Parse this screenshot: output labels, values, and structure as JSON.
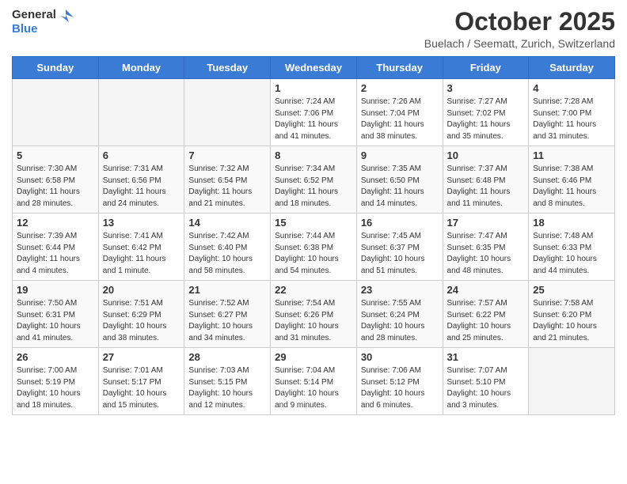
{
  "logo": {
    "text_general": "General",
    "text_blue": "Blue"
  },
  "header": {
    "month_title": "October 2025",
    "subtitle": "Buelach / Seematt, Zurich, Switzerland"
  },
  "days_of_week": [
    "Sunday",
    "Monday",
    "Tuesday",
    "Wednesday",
    "Thursday",
    "Friday",
    "Saturday"
  ],
  "weeks": [
    [
      {
        "day": "",
        "sunrise": "",
        "sunset": "",
        "daylight": "",
        "empty": true
      },
      {
        "day": "",
        "sunrise": "",
        "sunset": "",
        "daylight": "",
        "empty": true
      },
      {
        "day": "",
        "sunrise": "",
        "sunset": "",
        "daylight": "",
        "empty": true
      },
      {
        "day": "1",
        "sunrise": "Sunrise: 7:24 AM",
        "sunset": "Sunset: 7:06 PM",
        "daylight": "Daylight: 11 hours and 41 minutes."
      },
      {
        "day": "2",
        "sunrise": "Sunrise: 7:26 AM",
        "sunset": "Sunset: 7:04 PM",
        "daylight": "Daylight: 11 hours and 38 minutes."
      },
      {
        "day": "3",
        "sunrise": "Sunrise: 7:27 AM",
        "sunset": "Sunset: 7:02 PM",
        "daylight": "Daylight: 11 hours and 35 minutes."
      },
      {
        "day": "4",
        "sunrise": "Sunrise: 7:28 AM",
        "sunset": "Sunset: 7:00 PM",
        "daylight": "Daylight: 11 hours and 31 minutes."
      }
    ],
    [
      {
        "day": "5",
        "sunrise": "Sunrise: 7:30 AM",
        "sunset": "Sunset: 6:58 PM",
        "daylight": "Daylight: 11 hours and 28 minutes."
      },
      {
        "day": "6",
        "sunrise": "Sunrise: 7:31 AM",
        "sunset": "Sunset: 6:56 PM",
        "daylight": "Daylight: 11 hours and 24 minutes."
      },
      {
        "day": "7",
        "sunrise": "Sunrise: 7:32 AM",
        "sunset": "Sunset: 6:54 PM",
        "daylight": "Daylight: 11 hours and 21 minutes."
      },
      {
        "day": "8",
        "sunrise": "Sunrise: 7:34 AM",
        "sunset": "Sunset: 6:52 PM",
        "daylight": "Daylight: 11 hours and 18 minutes."
      },
      {
        "day": "9",
        "sunrise": "Sunrise: 7:35 AM",
        "sunset": "Sunset: 6:50 PM",
        "daylight": "Daylight: 11 hours and 14 minutes."
      },
      {
        "day": "10",
        "sunrise": "Sunrise: 7:37 AM",
        "sunset": "Sunset: 6:48 PM",
        "daylight": "Daylight: 11 hours and 11 minutes."
      },
      {
        "day": "11",
        "sunrise": "Sunrise: 7:38 AM",
        "sunset": "Sunset: 6:46 PM",
        "daylight": "Daylight: 11 hours and 8 minutes."
      }
    ],
    [
      {
        "day": "12",
        "sunrise": "Sunrise: 7:39 AM",
        "sunset": "Sunset: 6:44 PM",
        "daylight": "Daylight: 11 hours and 4 minutes."
      },
      {
        "day": "13",
        "sunrise": "Sunrise: 7:41 AM",
        "sunset": "Sunset: 6:42 PM",
        "daylight": "Daylight: 11 hours and 1 minute."
      },
      {
        "day": "14",
        "sunrise": "Sunrise: 7:42 AM",
        "sunset": "Sunset: 6:40 PM",
        "daylight": "Daylight: 10 hours and 58 minutes."
      },
      {
        "day": "15",
        "sunrise": "Sunrise: 7:44 AM",
        "sunset": "Sunset: 6:38 PM",
        "daylight": "Daylight: 10 hours and 54 minutes."
      },
      {
        "day": "16",
        "sunrise": "Sunrise: 7:45 AM",
        "sunset": "Sunset: 6:37 PM",
        "daylight": "Daylight: 10 hours and 51 minutes."
      },
      {
        "day": "17",
        "sunrise": "Sunrise: 7:47 AM",
        "sunset": "Sunset: 6:35 PM",
        "daylight": "Daylight: 10 hours and 48 minutes."
      },
      {
        "day": "18",
        "sunrise": "Sunrise: 7:48 AM",
        "sunset": "Sunset: 6:33 PM",
        "daylight": "Daylight: 10 hours and 44 minutes."
      }
    ],
    [
      {
        "day": "19",
        "sunrise": "Sunrise: 7:50 AM",
        "sunset": "Sunset: 6:31 PM",
        "daylight": "Daylight: 10 hours and 41 minutes."
      },
      {
        "day": "20",
        "sunrise": "Sunrise: 7:51 AM",
        "sunset": "Sunset: 6:29 PM",
        "daylight": "Daylight: 10 hours and 38 minutes."
      },
      {
        "day": "21",
        "sunrise": "Sunrise: 7:52 AM",
        "sunset": "Sunset: 6:27 PM",
        "daylight": "Daylight: 10 hours and 34 minutes."
      },
      {
        "day": "22",
        "sunrise": "Sunrise: 7:54 AM",
        "sunset": "Sunset: 6:26 PM",
        "daylight": "Daylight: 10 hours and 31 minutes."
      },
      {
        "day": "23",
        "sunrise": "Sunrise: 7:55 AM",
        "sunset": "Sunset: 6:24 PM",
        "daylight": "Daylight: 10 hours and 28 minutes."
      },
      {
        "day": "24",
        "sunrise": "Sunrise: 7:57 AM",
        "sunset": "Sunset: 6:22 PM",
        "daylight": "Daylight: 10 hours and 25 minutes."
      },
      {
        "day": "25",
        "sunrise": "Sunrise: 7:58 AM",
        "sunset": "Sunset: 6:20 PM",
        "daylight": "Daylight: 10 hours and 21 minutes."
      }
    ],
    [
      {
        "day": "26",
        "sunrise": "Sunrise: 7:00 AM",
        "sunset": "Sunset: 5:19 PM",
        "daylight": "Daylight: 10 hours and 18 minutes."
      },
      {
        "day": "27",
        "sunrise": "Sunrise: 7:01 AM",
        "sunset": "Sunset: 5:17 PM",
        "daylight": "Daylight: 10 hours and 15 minutes."
      },
      {
        "day": "28",
        "sunrise": "Sunrise: 7:03 AM",
        "sunset": "Sunset: 5:15 PM",
        "daylight": "Daylight: 10 hours and 12 minutes."
      },
      {
        "day": "29",
        "sunrise": "Sunrise: 7:04 AM",
        "sunset": "Sunset: 5:14 PM",
        "daylight": "Daylight: 10 hours and 9 minutes."
      },
      {
        "day": "30",
        "sunrise": "Sunrise: 7:06 AM",
        "sunset": "Sunset: 5:12 PM",
        "daylight": "Daylight: 10 hours and 6 minutes."
      },
      {
        "day": "31",
        "sunrise": "Sunrise: 7:07 AM",
        "sunset": "Sunset: 5:10 PM",
        "daylight": "Daylight: 10 hours and 3 minutes."
      },
      {
        "day": "",
        "sunrise": "",
        "sunset": "",
        "daylight": "",
        "empty": true
      }
    ]
  ]
}
